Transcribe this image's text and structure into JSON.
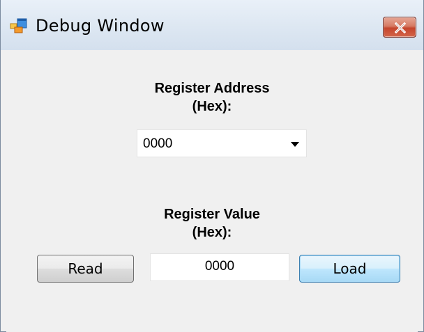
{
  "window": {
    "title": "Debug Window",
    "icons": {
      "app": "application-window-icon",
      "close": "close-icon"
    }
  },
  "form": {
    "address_label_line1": "Register Address",
    "address_label_line2": "(Hex):",
    "address_value": "0000",
    "value_label_line1": "Register Value",
    "value_label_line2": "(Hex):",
    "value_value": "0000",
    "read_label": "Read",
    "load_label": "Load"
  },
  "colors": {
    "close_button": "#c5452c",
    "title_bar": "#dde7f2",
    "default_button": "#a7d9f5"
  }
}
